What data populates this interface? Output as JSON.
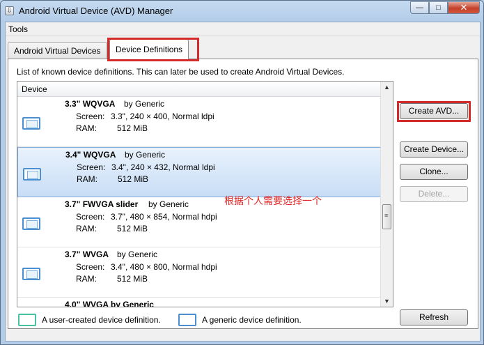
{
  "window": {
    "title": "Android Virtual Device (AVD) Manager",
    "minimize": "—",
    "maximize": "□",
    "close": "✕"
  },
  "menu": {
    "tools": "Tools"
  },
  "tabs": [
    {
      "label": "Android Virtual Devices"
    },
    {
      "label": "Device Definitions"
    }
  ],
  "panel": {
    "description": "List of known device definitions. This can later be used to create Android Virtual Devices.",
    "column_header": "Device"
  },
  "devices": [
    {
      "name": "3.3\" WQVGA",
      "by": "by Generic",
      "screen_label": "Screen:",
      "screen": "3.3\", 240 × 400, Normal ldpi",
      "ram_label": "RAM:",
      "ram": "512 MiB"
    },
    {
      "name": "3.4\" WQVGA",
      "by": "by Generic",
      "screen_label": "Screen:",
      "screen": "3.4\", 240 × 432, Normal ldpi",
      "ram_label": "RAM:",
      "ram": "512 MiB"
    },
    {
      "name": "3.7\" FWVGA slider",
      "by": "by Generic",
      "screen_label": "Screen:",
      "screen": "3.7\", 480 × 854, Normal hdpi",
      "ram_label": "RAM:",
      "ram": "512 MiB"
    },
    {
      "name": "3.7\" WVGA",
      "by": "by Generic",
      "screen_label": "Screen:",
      "screen": "3.4\", 480 × 800, Normal hdpi",
      "ram_label": "RAM:",
      "ram": "512 MiB"
    }
  ],
  "partial_row": "4.0\" WVGA   by Generic",
  "annotation": "根据个人需要选择一个",
  "buttons": {
    "create_avd": "Create AVD...",
    "create_device": "Create Device...",
    "clone": "Clone...",
    "delete": "Delete...",
    "refresh": "Refresh"
  },
  "legend": {
    "user": "A user-created device definition.",
    "generic": "A generic device definition."
  },
  "colors": {
    "highlight": "#d42a2a",
    "selection": "#c8ddf6",
    "annotation": "#e12525"
  }
}
